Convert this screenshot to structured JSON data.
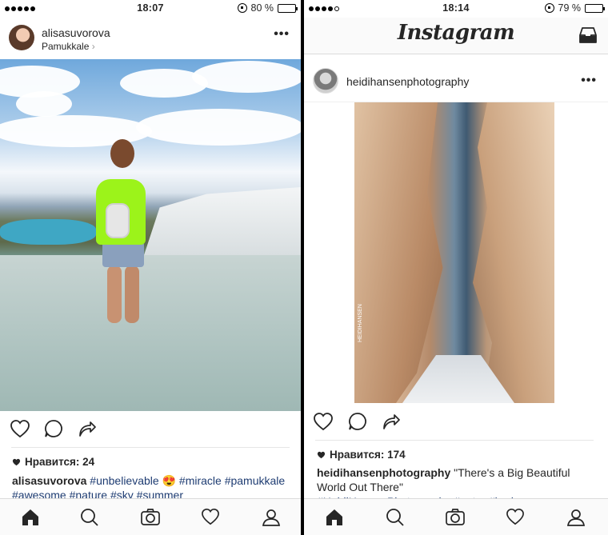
{
  "left": {
    "status": {
      "time": "18:07",
      "battery": "80 %",
      "battery_level": 0.8
    },
    "post": {
      "username": "alisasuvorova",
      "location": "Pamukkale",
      "more": "•••",
      "likes": "Нравится: 24",
      "caption_user": "alisasuvorova",
      "caption_tags": [
        "#unbelievable",
        "😍",
        "#miracle",
        "#pamukkale",
        "#awesome",
        "#nature",
        "#sky",
        "#summer"
      ]
    }
  },
  "right": {
    "status": {
      "time": "18:14",
      "battery": "79 %",
      "battery_level": 0.79
    },
    "header": {
      "logo": "Instagram"
    },
    "post": {
      "username": "heidihansenphotography",
      "more": "•••",
      "watermark": "HEIDIHANSEN",
      "likes": "Нравится: 174",
      "caption_user": "heidihansenphotography",
      "caption_text": "\"There's a Big Beautiful World Out There\"",
      "caption_tags_partial": "#HeidiHansenPhotography #petra #jordan ... еще"
    }
  },
  "icons": {
    "like": "heart-icon",
    "comment": "comment-icon",
    "share": "share-icon",
    "home": "home-icon",
    "search": "search-icon",
    "camera": "camera-icon",
    "activity": "heart-icon",
    "profile": "profile-icon",
    "inbox": "inbox-icon"
  }
}
